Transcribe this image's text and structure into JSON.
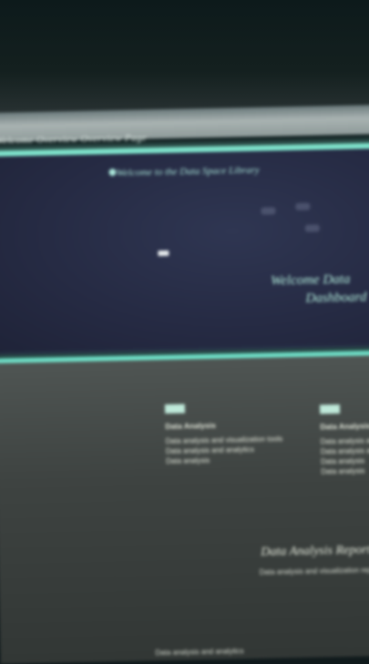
{
  "site": {
    "title": "Welcome Overview Overview Page"
  },
  "hero": {
    "subtitle": "Welcome to the Data Space Library",
    "heading_line1": "Welcome Data",
    "heading_line2": "Dashboard"
  },
  "columns": [
    {
      "heading": "Data Analysis",
      "lines": [
        "Data analysis and visualization tools",
        "Data analysis and analytics",
        "Data analysis"
      ]
    },
    {
      "heading": "Data Analysis",
      "lines": [
        "Data analysis and",
        "Data analysis and",
        "Data analysis",
        "Data analysis"
      ]
    }
  ],
  "footer": {
    "heading": "Data Analysis Report",
    "line": "Data analysis and visualization reporting",
    "bottom": "Data analysis and analytics"
  }
}
